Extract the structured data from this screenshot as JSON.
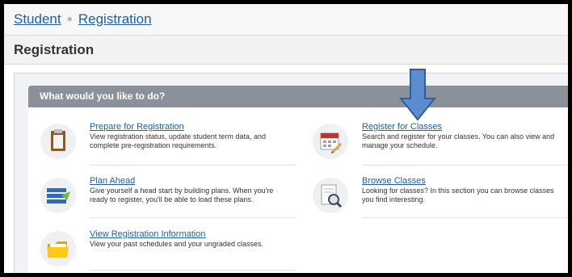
{
  "breadcrumb": {
    "items": [
      "Student",
      "Registration"
    ]
  },
  "page": {
    "title": "Registration"
  },
  "panel": {
    "header": "What would you like to do?"
  },
  "items": [
    {
      "title": "Prepare for Registration",
      "desc": "View registration status, update student term data, and complete pre-registration requirements.",
      "icon": "clipboard-icon"
    },
    {
      "title": "Register for Classes",
      "desc": "Search and register for your classes. You can also view and manage your schedule.",
      "icon": "calendar-icon"
    },
    {
      "title": "Plan Ahead",
      "desc": "Give yourself a head start by building plans. When you're ready to register, you'll be able to load these plans.",
      "icon": "plan-list-icon"
    },
    {
      "title": "Browse Classes",
      "desc": "Looking for classes? In this section you can browse classes you find interesting.",
      "icon": "magnifier-document-icon"
    },
    {
      "title": "View Registration Information",
      "desc": "View your past schedules and your ungraded classes.",
      "icon": "folder-icon"
    }
  ],
  "colors": {
    "link": "#1f5fa6",
    "header_bar": "#8b9198",
    "arrow": "#5b8ccf"
  }
}
